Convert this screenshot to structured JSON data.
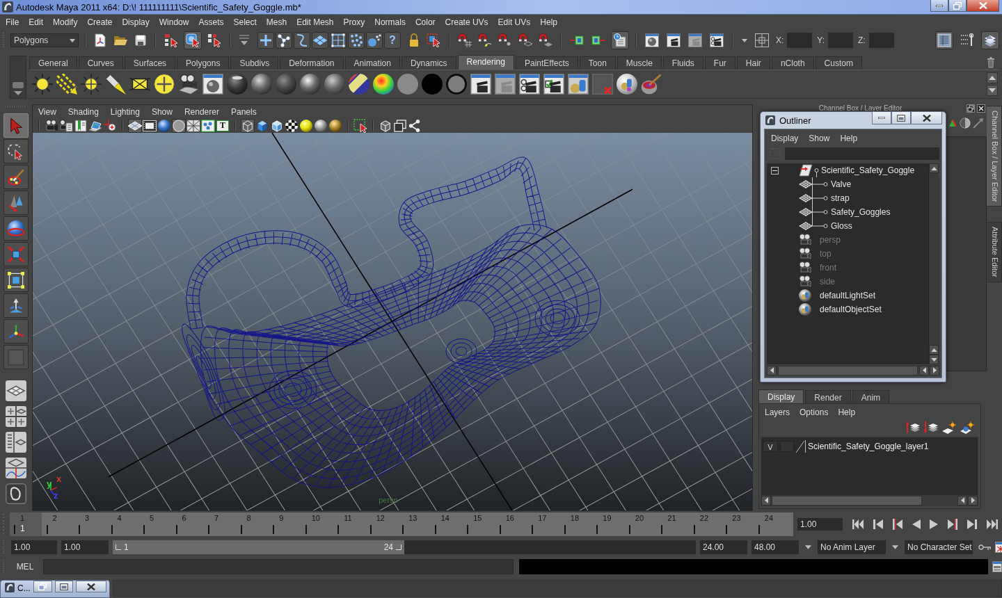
{
  "window": {
    "title": "Autodesk Maya 2011 x64: D:\\! 111111111\\Scientific_Safety_Goggle.mb*"
  },
  "menu_bar": [
    "File",
    "Edit",
    "Modify",
    "Create",
    "Display",
    "Window",
    "Assets",
    "Select",
    "Mesh",
    "Edit Mesh",
    "Proxy",
    "Normals",
    "Color",
    "Create UVs",
    "Edit UVs",
    "Help"
  ],
  "status_line": {
    "menu_set": "Polygons",
    "selection_modes": [
      {
        "selected": false
      },
      {
        "selected": true
      },
      {
        "selected": false
      }
    ],
    "help_button": "?",
    "history_on": true,
    "coordinate_labels": [
      "X:",
      "Y:",
      "Z:"
    ],
    "panel_toggles": [
      {
        "on": true
      },
      {
        "on": false
      },
      {
        "on": true
      }
    ]
  },
  "shelf": {
    "tabs": [
      {
        "label": "General",
        "selected": false
      },
      {
        "label": "Curves",
        "selected": false
      },
      {
        "label": "Surfaces",
        "selected": false
      },
      {
        "label": "Polygons",
        "selected": false
      },
      {
        "label": "Subdivs",
        "selected": false
      },
      {
        "label": "Deformation",
        "selected": false
      },
      {
        "label": "Animation",
        "selected": false
      },
      {
        "label": "Dynamics",
        "selected": false
      },
      {
        "label": "Rendering",
        "selected": true
      },
      {
        "label": "PaintEffects",
        "selected": false
      },
      {
        "label": "Toon",
        "selected": false
      },
      {
        "label": "Muscle",
        "selected": false
      },
      {
        "label": "Fluids",
        "selected": false
      },
      {
        "label": "Fur",
        "selected": false
      },
      {
        "label": "Hair",
        "selected": false
      },
      {
        "label": "nCloth",
        "selected": false
      },
      {
        "label": "Custom",
        "selected": false
      }
    ]
  },
  "toolbox": {
    "tools": [
      {
        "selected": true
      },
      {
        "selected": false
      },
      {
        "selected": false
      },
      {
        "selected": false
      },
      {
        "selected": false
      },
      {
        "selected": false
      },
      {
        "selected": false
      },
      {
        "selected": false
      },
      {
        "selected": false
      },
      {
        "selected": false
      }
    ]
  },
  "viewport": {
    "menu": [
      "View",
      "Shading",
      "Lighting",
      "Show",
      "Renderer",
      "Panels"
    ],
    "toolbar": [
      {
        "on": false
      },
      {
        "on": false
      },
      {
        "on": false
      },
      {
        "on": false
      },
      {
        "on": false
      },
      {
        "on": true
      },
      {
        "on": false
      },
      {
        "on": false
      },
      {
        "on": true
      },
      {
        "on": false
      },
      {
        "on": false
      },
      {
        "on": false,
        "label": "T"
      },
      {
        "on": true
      },
      {
        "on": false
      },
      {
        "on": false
      },
      {
        "on": false
      },
      {
        "on": false
      },
      {
        "on": false
      },
      {
        "on": false
      },
      {
        "on": false
      },
      {
        "on": false
      },
      {
        "on": false
      },
      {
        "on": false
      }
    ],
    "camera": "persp",
    "axis_labels": [
      "y",
      "x",
      "z"
    ]
  },
  "channel_box": {
    "title": "Channel Box / Layer Editor"
  },
  "outliner": {
    "title": "Outliner",
    "menu": [
      "Display",
      "Show",
      "Help"
    ],
    "items": [
      {
        "name": "Scientific_Safety_Goggle",
        "kind": "transform",
        "dimmed": false,
        "expanded": true,
        "children": [
          {
            "name": "Valve",
            "kind": "mesh",
            "dimmed": false
          },
          {
            "name": "strap",
            "kind": "mesh",
            "dimmed": false
          },
          {
            "name": "Safety_Goggles",
            "kind": "mesh",
            "dimmed": false
          },
          {
            "name": "Gloss",
            "kind": "mesh",
            "dimmed": false
          }
        ]
      },
      {
        "name": "persp",
        "kind": "camera",
        "dimmed": true
      },
      {
        "name": "top",
        "kind": "camera",
        "dimmed": true
      },
      {
        "name": "front",
        "kind": "camera",
        "dimmed": true
      },
      {
        "name": "side",
        "kind": "camera",
        "dimmed": true
      },
      {
        "name": "defaultLightSet",
        "kind": "set",
        "dimmed": false
      },
      {
        "name": "defaultObjectSet",
        "kind": "set",
        "dimmed": false
      }
    ]
  },
  "side_tabs": [
    {
      "label": "Channel Box / Layer Editor",
      "selected": true
    },
    {
      "label": "Attribute Editor",
      "selected": false
    }
  ],
  "layer_editor": {
    "tabs": [
      {
        "label": "Display",
        "selected": true
      },
      {
        "label": "Render",
        "selected": false
      },
      {
        "label": "Anim",
        "selected": false
      }
    ],
    "menu": [
      "Layers",
      "Options",
      "Help"
    ],
    "layers": [
      {
        "visibility": "V",
        "name": "Scientific_Safety_Goggle_layer1"
      }
    ]
  },
  "time_slider": {
    "frames": [
      {
        "label": "1",
        "selected": true
      },
      {
        "label": "2",
        "selected": false
      },
      {
        "label": "3",
        "selected": false
      },
      {
        "label": "4",
        "selected": false
      },
      {
        "label": "5",
        "selected": false
      },
      {
        "label": "6",
        "selected": false
      },
      {
        "label": "7",
        "selected": false
      },
      {
        "label": "8",
        "selected": false
      },
      {
        "label": "9",
        "selected": false
      },
      {
        "label": "10",
        "selected": false
      },
      {
        "label": "11",
        "selected": false
      },
      {
        "label": "12",
        "selected": false
      },
      {
        "label": "13",
        "selected": false
      },
      {
        "label": "14",
        "selected": false
      },
      {
        "label": "15",
        "selected": false
      },
      {
        "label": "16",
        "selected": false
      },
      {
        "label": "17",
        "selected": false
      },
      {
        "label": "18",
        "selected": false
      },
      {
        "label": "19",
        "selected": false
      },
      {
        "label": "20",
        "selected": false
      },
      {
        "label": "21",
        "selected": false
      },
      {
        "label": "22",
        "selected": false
      },
      {
        "label": "23",
        "selected": false
      },
      {
        "label": "24",
        "selected": false
      }
    ],
    "current_marker": "1",
    "current_time": "1.00"
  },
  "range_slider": {
    "start_time": "1.00",
    "playback_start": "1.00",
    "range_start": "1",
    "range_end": "24",
    "level": 0.5,
    "playback_end": "24.00",
    "end_time": "48.00",
    "anim_layer": "No Anim Layer",
    "character_set": "No Character Set"
  },
  "command_line": {
    "language": "MEL"
  },
  "taskbar": {
    "minimized_window": "C..."
  }
}
